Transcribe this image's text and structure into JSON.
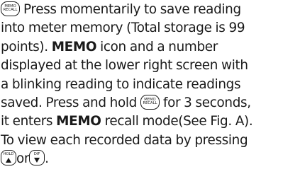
{
  "icons": {
    "memo_recall": {
      "name": "memo-recall-button-icon",
      "line1": "MEMO",
      "line2": "RECALL"
    },
    "hold": {
      "name": "hold-up-button-icon",
      "label": "HOLD"
    },
    "dif": {
      "name": "dif-down-button-icon",
      "label": "DIF"
    }
  },
  "paragraph": {
    "line1_text": "Press momentarily to save reading",
    "line2": "into meter memory (Total storage is 99",
    "line3": "points).",
    "line3_bold": "MEMO",
    "line3_rest": "icon and a number",
    "line4": "displayed at the lower right screen with",
    "line5": "a blinking reading to indicate readings",
    "line6_start": "saved. Press and hold",
    "line6_end": "for 3 seconds,",
    "line7_start": "it enters",
    "line7_bold": "MEMO",
    "line7_end": "recall mode(See Fig. A).",
    "line8": "To view each recorded data by pressing",
    "line9_mid": "or",
    "line9_end": "."
  }
}
